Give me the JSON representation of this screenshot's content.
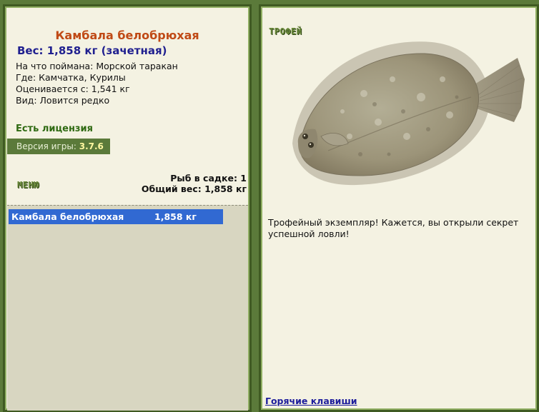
{
  "fish": {
    "name": "Камбала белобрюхая",
    "weight_line": "Вес: 1,858 кг (зачетная)",
    "caught_on": "На что поймана: Морской таракан",
    "where": "Где: Камчатка, Курилы",
    "valued_from": "Оценивается с: 1,541 кг",
    "kind": "Вид: Ловится редко"
  },
  "license": "Есть лицензия",
  "version": {
    "label": "Версия игры:",
    "value": "3.7.6"
  },
  "menu_label": "МЕНЮ",
  "cage": {
    "count_line": "Рыб в садке: 1",
    "total_line": "Общий вес: 1,858 кг"
  },
  "cage_list": [
    {
      "name": "Камбала белобрюхая",
      "weight": "1,858 кг"
    }
  ],
  "trophy": {
    "label": "ТРОФЕЙ",
    "text": "Трофейный экземпляр! Кажется, вы открыли секрет успешной ловли!"
  },
  "hotkeys": "Горячие клавиши",
  "colors": {
    "background": "#5b7a3a",
    "panel": "#f4f2e2",
    "title": "#c04a16",
    "weight": "#1f1f8f",
    "selection": "#3169d2",
    "license": "#2f6a12"
  },
  "icons": {
    "fish": "flounder-fish-image"
  }
}
